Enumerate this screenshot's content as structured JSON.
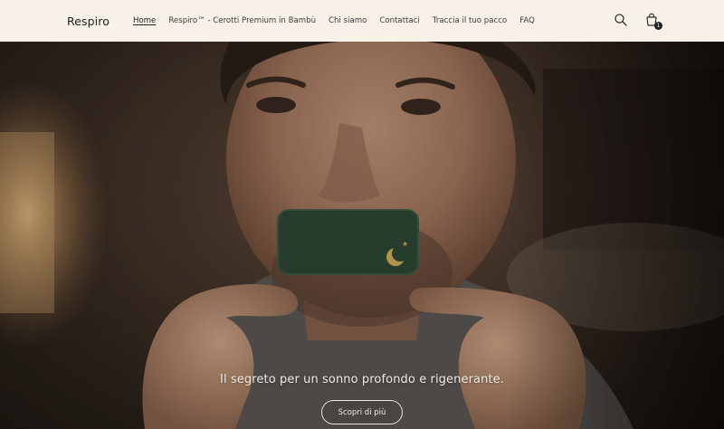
{
  "header": {
    "logo": "Respiro",
    "nav": [
      {
        "label": "Home",
        "active": true
      },
      {
        "label": "Respiro™ - Cerotti Premium in Bambù",
        "active": false
      },
      {
        "label": "Chi siamo",
        "active": false
      },
      {
        "label": "Contattaci",
        "active": false
      },
      {
        "label": "Traccia il tuo pacco",
        "active": false
      },
      {
        "label": "FAQ",
        "active": false
      }
    ],
    "icons": {
      "search": "search-icon",
      "cart": "cart-icon"
    },
    "cart_count": "1"
  },
  "hero": {
    "tagline": "Il segreto per un sonno profondo e rigenerante.",
    "cta_label": "Scopri di più"
  },
  "colors": {
    "header_bg": "#f7f1e8",
    "strip_green": "#2f4a36",
    "moon_gold": "#d8b35a"
  }
}
